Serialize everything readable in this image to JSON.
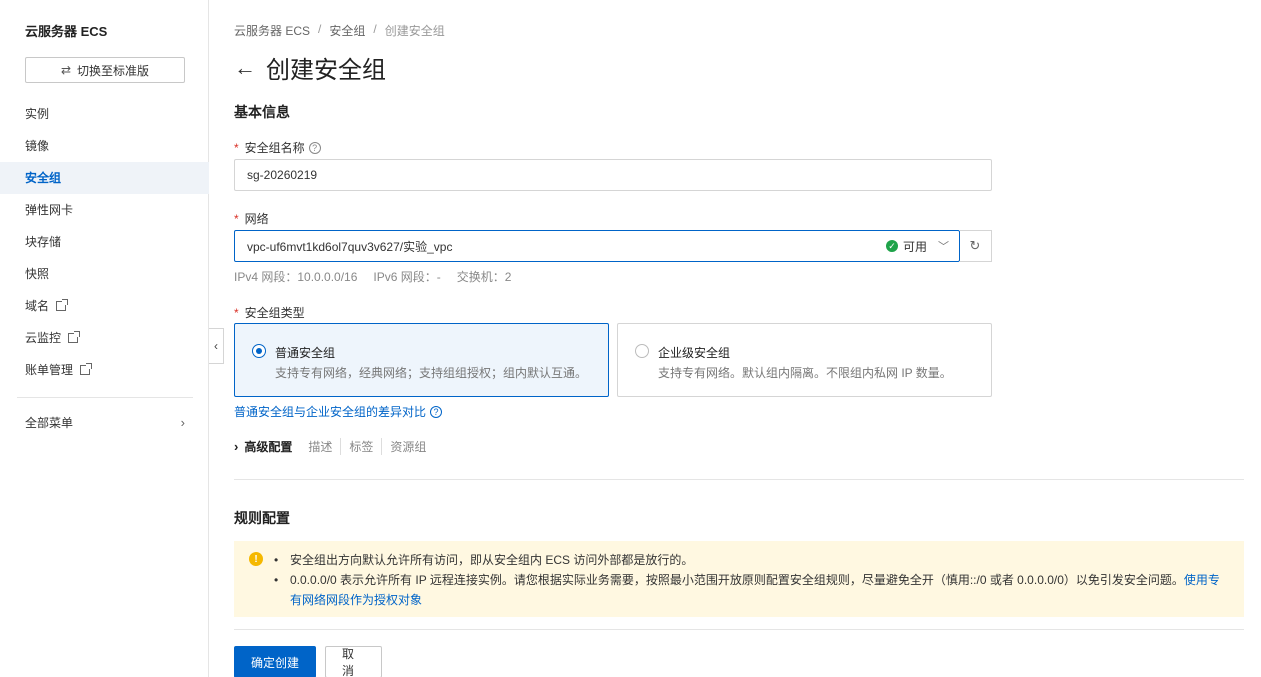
{
  "sidebar": {
    "title": "云服务器 ECS",
    "switch_label": "切换至标准版",
    "items": [
      {
        "label": "实例"
      },
      {
        "label": "镜像"
      },
      {
        "label": "安全组"
      },
      {
        "label": "弹性网卡"
      },
      {
        "label": "块存储"
      },
      {
        "label": "快照"
      },
      {
        "label": "域名"
      },
      {
        "label": "云监控"
      },
      {
        "label": "账单管理"
      }
    ],
    "all_menu": "全部菜单"
  },
  "breadcrumb": [
    "云服务器 ECS",
    "安全组",
    "创建安全组"
  ],
  "page_title": "创建安全组",
  "basic": {
    "section_title": "基本信息",
    "name_label": "安全组名称",
    "name_value": "sg-20260219",
    "network_label": "网络",
    "network_value": "vpc-uf6mvt1kd6ol7quv3v627/实验_vpc",
    "network_status": "可用",
    "network_info": {
      "ipv4": "IPv4 网段：10.0.0.0/16",
      "ipv6": "IPv6 网段：-",
      "switch": "交换机：2"
    },
    "type_label": "安全组类型",
    "type_options": [
      {
        "title": "普通安全组",
        "desc": "支持专有网络，经典网络；支持组组授权；组内默认互通。"
      },
      {
        "title": "企业级安全组",
        "desc": "支持专有网络。默认组内隔离。不限组内私网 IP 数量。"
      }
    ],
    "compare_link": "普通安全组与企业安全组的差异对比",
    "advanced": {
      "label": "高级配置",
      "sub": [
        "描述",
        "标签",
        "资源组"
      ]
    }
  },
  "rules": {
    "section_title": "规则配置",
    "alert_1": "安全组出方向默认允许所有访问，即从安全组内 ECS 访问外部都是放行的。",
    "alert_2": "0.0.0.0/0 表示允许所有 IP 远程连接实例。请您根据实际业务需要，按照最小范围开放原则配置安全组规则，尽量避免全开（慎用::/0 或者 0.0.0.0/0）以免引发安全问题。",
    "alert_link": "使用专有网络网段作为授权对象"
  },
  "actions": {
    "confirm": "确定创建",
    "cancel": "取消"
  },
  "colors": {
    "primary": "#0064c8",
    "available": "#1fa34a",
    "warning_bg": "#fff8e1",
    "warning_icon": "#f5b800",
    "required": "#d93026"
  }
}
